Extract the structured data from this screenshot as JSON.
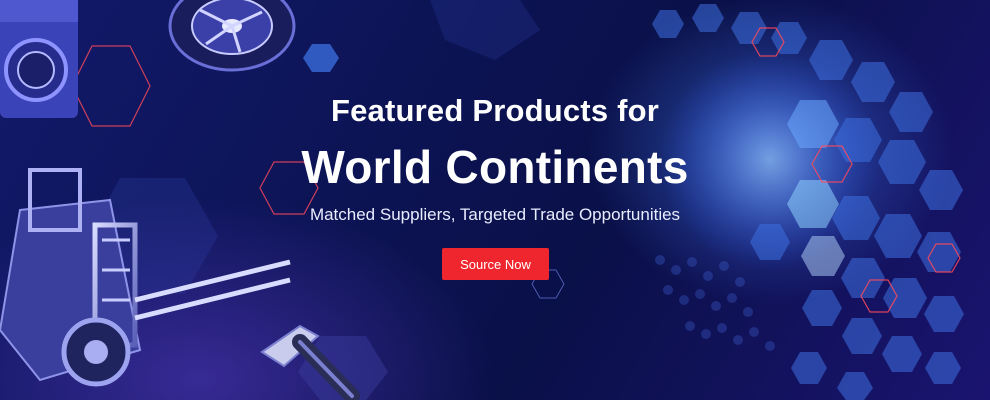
{
  "hero": {
    "title_line1": "Featured Products for",
    "title_line2": "World Continents",
    "subtitle": "Matched Suppliers, Targeted Trade Opportunities",
    "cta_label": "Source Now"
  },
  "colors": {
    "background": "#0d1456",
    "accent_red": "#f0262f",
    "hex_blue": "#4a8cff",
    "hex_outline_red": "#ff3b3b"
  },
  "images": [
    {
      "name": "tire-wheel-image"
    },
    {
      "name": "washing-machine-image"
    },
    {
      "name": "forklift-image"
    },
    {
      "name": "hammer-image"
    },
    {
      "name": "hexagon-globe-image"
    }
  ]
}
